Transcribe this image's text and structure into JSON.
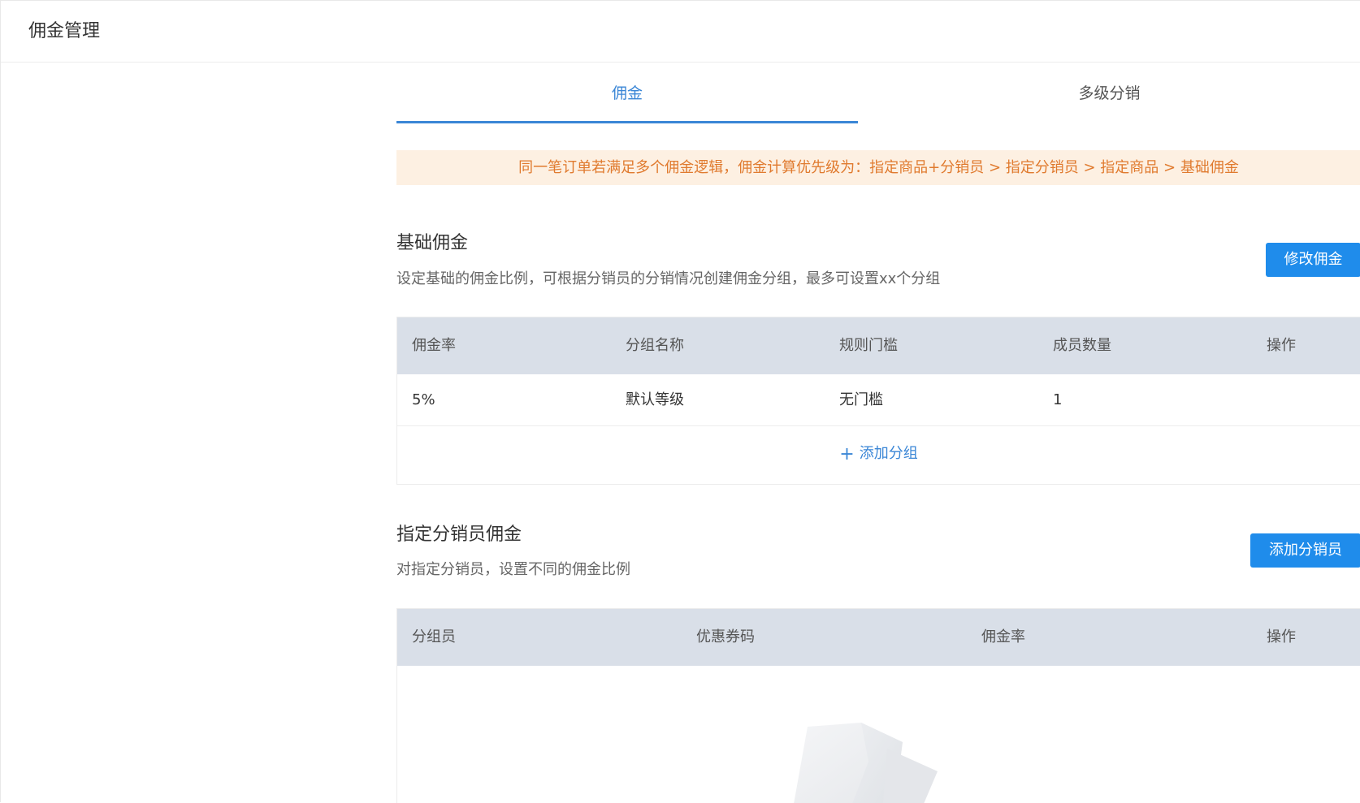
{
  "header": {
    "title": "佣金管理"
  },
  "tabs": [
    {
      "label": "佣金",
      "active": true
    },
    {
      "label": "多级分销",
      "active": false
    }
  ],
  "notice": {
    "text": "同一笔订单若满足多个佣金逻辑，佣金计算优先级为：指定商品+分销员 > 指定分销员 > 指定商品 > 基础佣金"
  },
  "basic": {
    "title": "基础佣金",
    "desc": "设定基础的佣金比例，可根据分销员的分销情况创建佣金分组，最多可设置xx个分组",
    "button": "修改佣金",
    "columns": [
      "佣金率",
      "分组名称",
      "规则门槛",
      "成员数量",
      "操作"
    ],
    "rows": [
      {
        "rate": "5%",
        "name": "默认等级",
        "threshold": "无门槛",
        "members": "1",
        "action": ""
      }
    ],
    "add_group": "添加分组"
  },
  "designated": {
    "title": "指定分销员佣金",
    "desc": "对指定分销员，设置不同的佣金比例",
    "button": "添加分销员",
    "columns": [
      "分组员",
      "优惠券码",
      "佣金率",
      "操作"
    ]
  },
  "colors": {
    "accent": "#3a86d6",
    "button": "#1f8ceb",
    "notice_bg": "#fdf0e2",
    "notice_text": "#e07a2e",
    "table_header": "#d9dfe8"
  }
}
